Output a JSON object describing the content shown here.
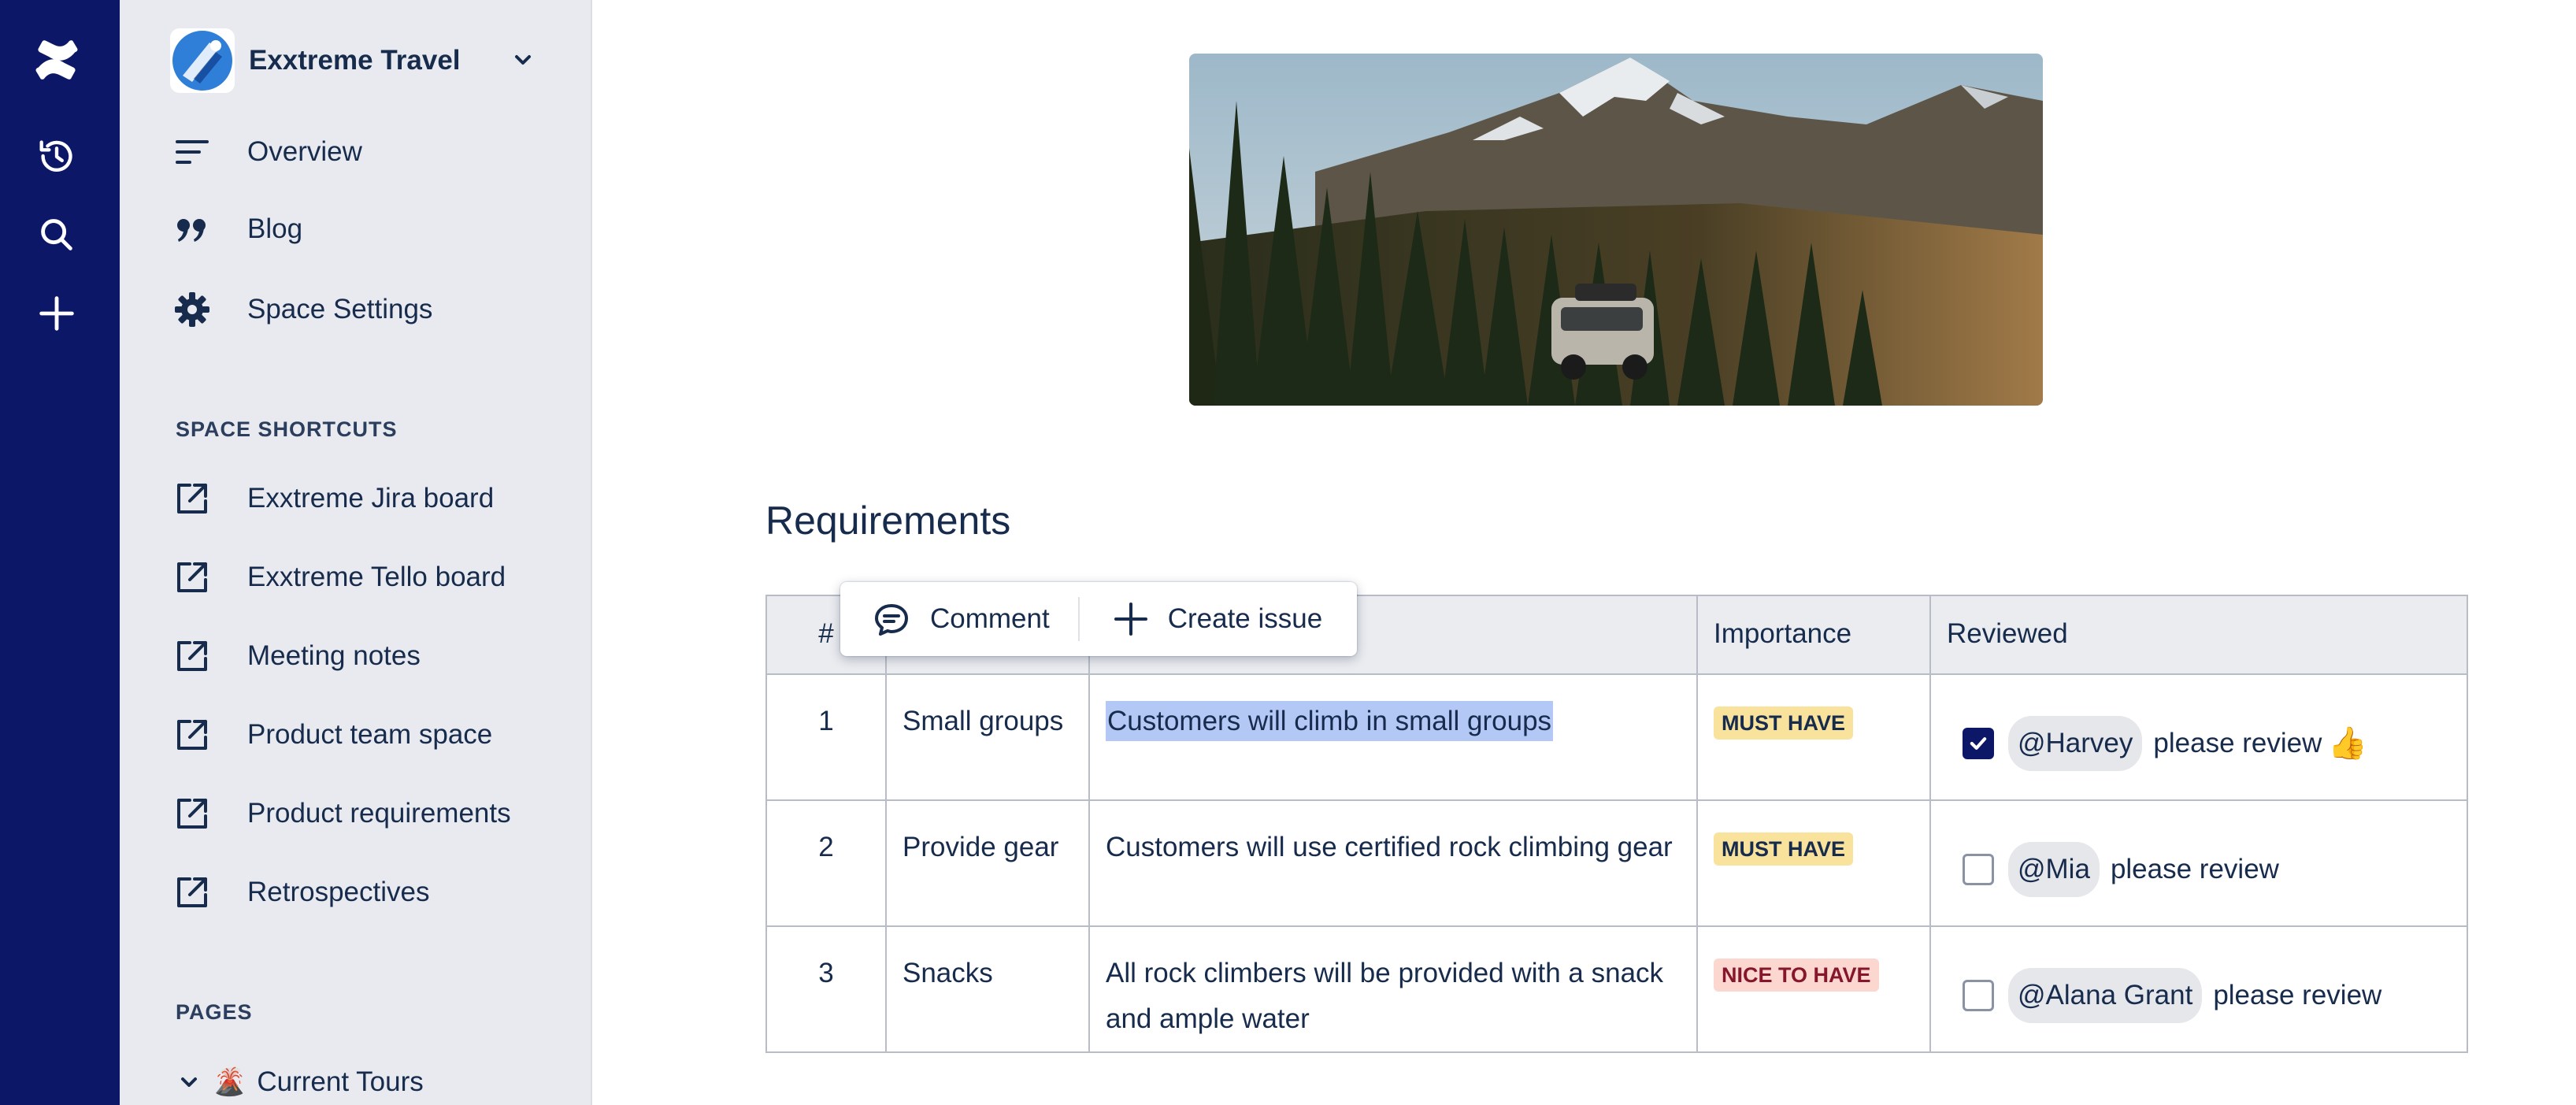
{
  "space": {
    "name": "Exxtreme Travel"
  },
  "sidebar": {
    "items": [
      {
        "label": "Overview",
        "icon": "overview-icon"
      },
      {
        "label": "Blog",
        "icon": "quote-icon"
      },
      {
        "label": "Space Settings",
        "icon": "gear-icon"
      }
    ],
    "shortcuts_heading": "SPACE SHORTCUTS",
    "shortcuts": [
      {
        "label": "Exxtreme Jira board"
      },
      {
        "label": "Exxtreme Tello board"
      },
      {
        "label": "Meeting notes"
      },
      {
        "label": "Product team space"
      },
      {
        "label": "Product requirements"
      },
      {
        "label": "Retrospectives"
      }
    ],
    "pages_heading": "PAGES",
    "pages": [
      {
        "label": "Current Tours",
        "emoji": "🌋"
      }
    ]
  },
  "toolbar": {
    "comment_label": "Comment",
    "create_issue_label": "Create issue"
  },
  "content": {
    "heading": "Requirements",
    "table": {
      "headers": [
        "#",
        "",
        "",
        "Importance",
        "Reviewed"
      ],
      "rows": [
        {
          "num": "1",
          "title": "Small groups",
          "description": "Customers will climb in small groups",
          "importance": "MUST HAVE",
          "checked": true,
          "mention": "@Harvey",
          "note": "please review",
          "emoji": "👍"
        },
        {
          "num": "2",
          "title": "Provide gear",
          "description": "Customers will use certified rock climbing gear",
          "importance": "MUST HAVE",
          "checked": false,
          "mention": "@Mia",
          "note": "please review"
        },
        {
          "num": "3",
          "title": "Snacks",
          "description": "All rock climbers will be provided with a snack and ample water",
          "importance": "NICE TO HAVE",
          "checked": false,
          "mention": "@Alana Grant",
          "note": "please review"
        }
      ]
    }
  },
  "colors": {
    "rail": "#0c1768",
    "sidebar": "#e9eaef",
    "text": "#172b4d",
    "highlight": "#b3c8f5",
    "must_have": "#f8e29c",
    "nice_to_have": "#fbd7d0"
  }
}
